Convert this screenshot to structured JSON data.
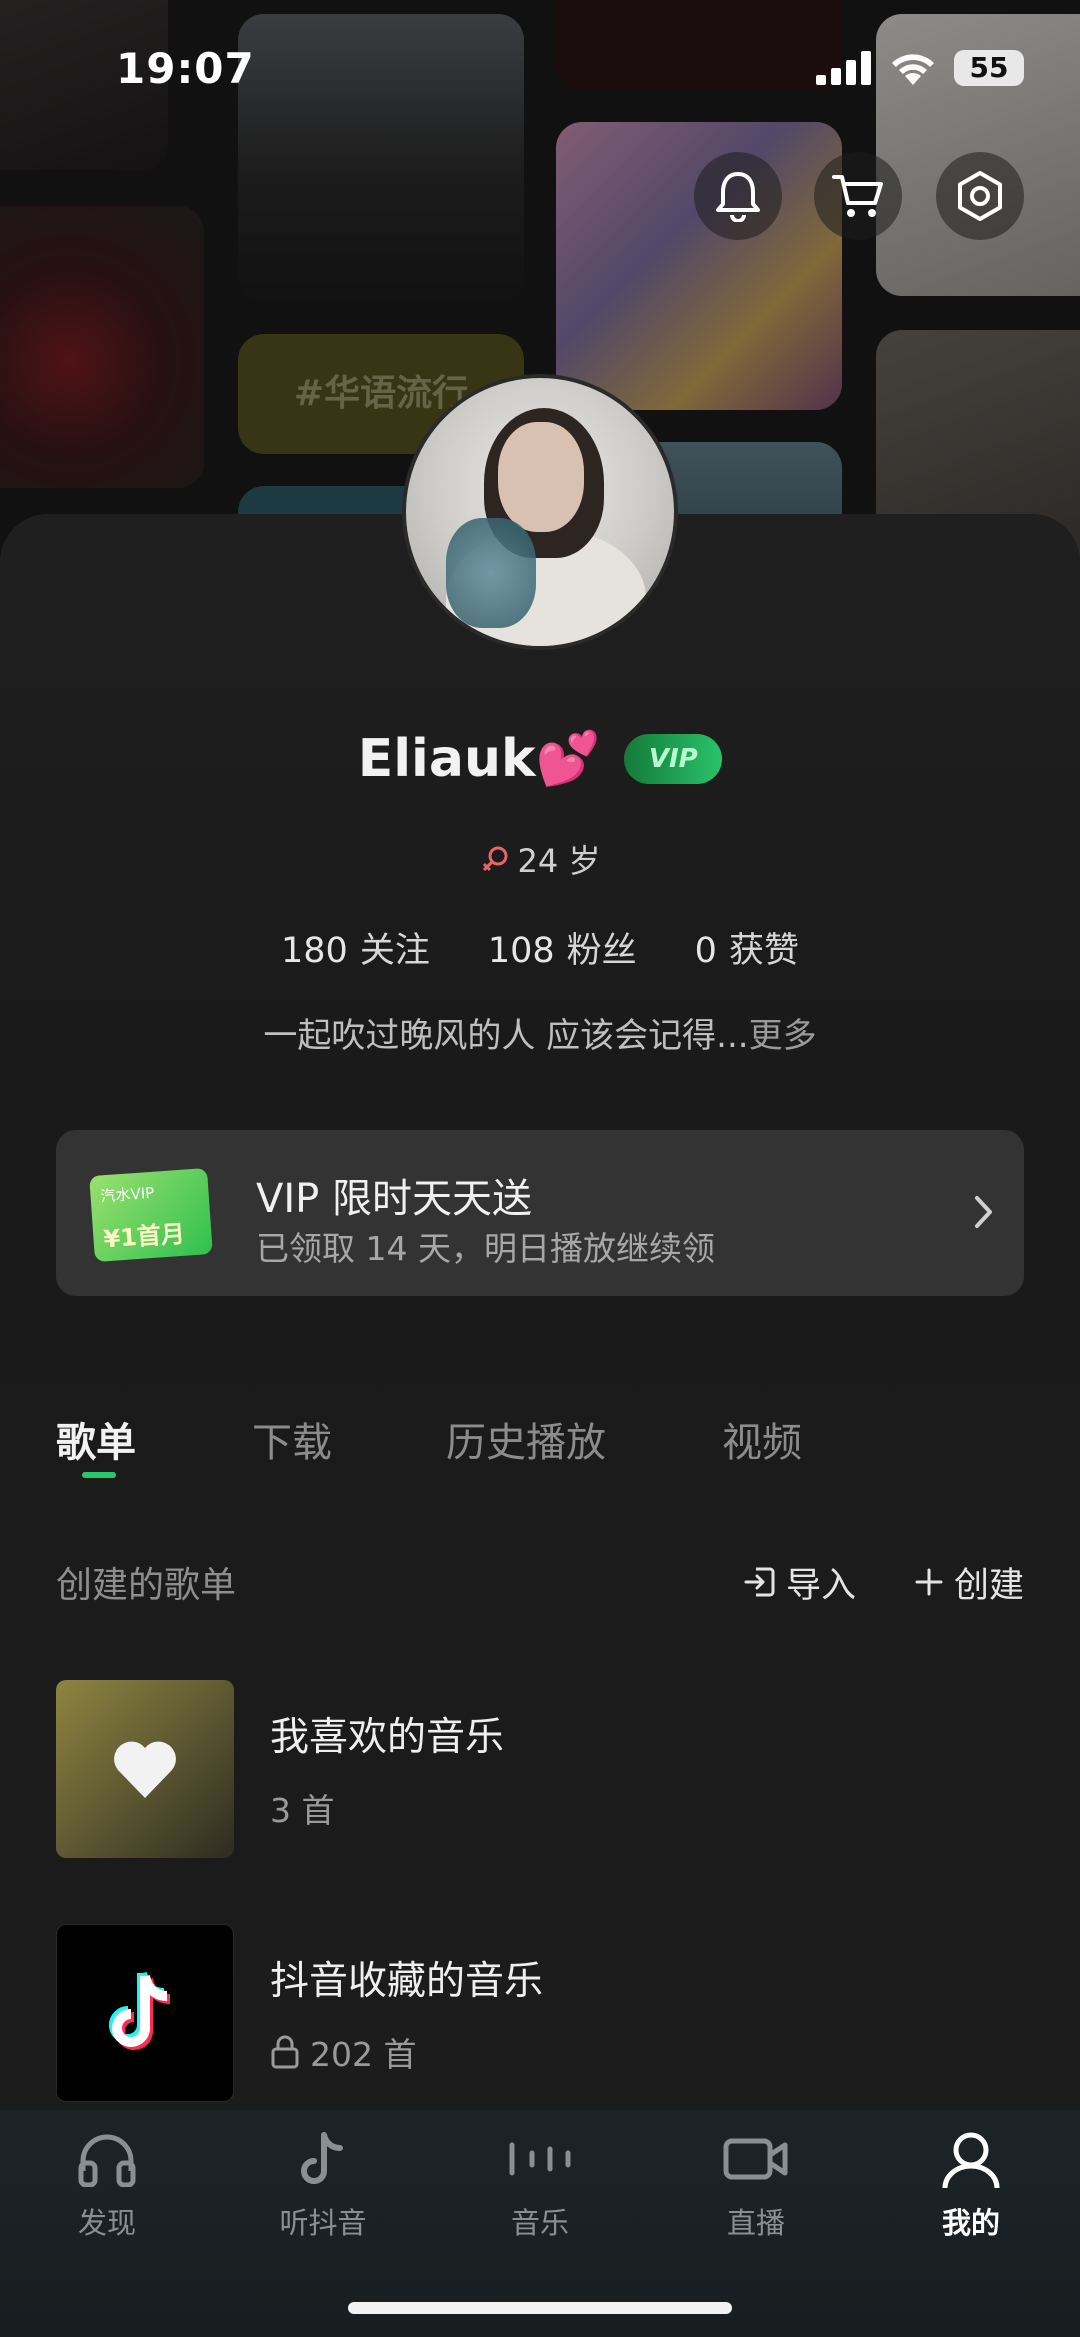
{
  "status_bar": {
    "time": "19:07",
    "battery": "55"
  },
  "background": {
    "tag": "#华语流行"
  },
  "header_buttons": {
    "notification": "bell-icon",
    "cart": "cart-icon",
    "settings": "settings-icon"
  },
  "profile": {
    "username": "Eliauk💕",
    "vip_label": "VIP",
    "age": "24 岁",
    "stats": [
      {
        "value": "180",
        "label": "关注"
      },
      {
        "value": "108",
        "label": "粉丝"
      },
      {
        "value": "0",
        "label": "获赞"
      }
    ],
    "bio": "一起吹过晚风的人 应该会记得...",
    "bio_more": "更多"
  },
  "promo": {
    "ticket_line1": "汽水VIP",
    "ticket_line2": "¥1首月",
    "title": "VIP 限时天天送",
    "subtitle": "已领取 14 天，明日播放继续领"
  },
  "tabs": [
    {
      "label": "歌单",
      "active": true
    },
    {
      "label": "下载",
      "active": false
    },
    {
      "label": "历史播放",
      "active": false
    },
    {
      "label": "视频",
      "active": false
    }
  ],
  "section": {
    "title": "创建的歌单",
    "import": "导入",
    "create": "创建"
  },
  "playlists": [
    {
      "title": "我喜欢的音乐",
      "count": "3 首"
    },
    {
      "title": "抖音收藏的音乐",
      "count": "202 首"
    }
  ],
  "bottom_nav": [
    {
      "label": "发现",
      "active": false
    },
    {
      "label": "听抖音",
      "active": false
    },
    {
      "label": "音乐",
      "active": false
    },
    {
      "label": "直播",
      "active": false
    },
    {
      "label": "我的",
      "active": true
    }
  ],
  "colors": {
    "accent": "#28c769",
    "female": "#e96565",
    "card_bg": "#1c1c1c"
  }
}
